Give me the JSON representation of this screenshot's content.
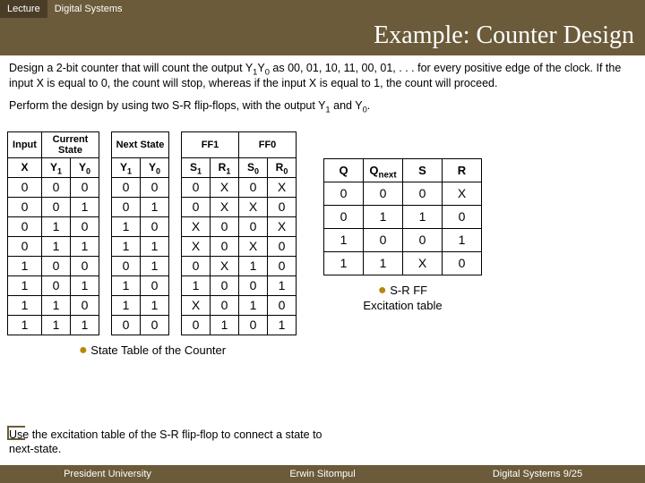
{
  "header": {
    "left": "Lecture",
    "right": "Digital Systems"
  },
  "title": "Example: Counter Design",
  "para1_a": "Design a 2-bit counter that will count the output Y",
  "para1_b": "Y",
  "para1_c": " as 00, 01, 10, 11, 00, 01, . . . for every positive edge of the clock. If the input X is equal to 0, the count will stop, whereas if the input X is equal to 1, the count will proceed.",
  "para2_a": "Perform the design by using two S-R flip-flops, with the output Y",
  "para2_b": " and Y",
  "state_table": {
    "group_headers": [
      "Input",
      "Current State",
      "Next State",
      "FF1",
      "FF0"
    ],
    "sub_headers": [
      "X",
      "Y1",
      "Y0",
      "Y1",
      "Y0",
      "S1",
      "R1",
      "S0",
      "R0"
    ],
    "rows": [
      [
        "0",
        "0",
        "0",
        "0",
        "0",
        "0",
        "X",
        "0",
        "X"
      ],
      [
        "0",
        "0",
        "1",
        "0",
        "1",
        "0",
        "X",
        "X",
        "0"
      ],
      [
        "0",
        "1",
        "0",
        "1",
        "0",
        "X",
        "0",
        "0",
        "X"
      ],
      [
        "0",
        "1",
        "1",
        "1",
        "1",
        "X",
        "0",
        "X",
        "0"
      ],
      [
        "1",
        "0",
        "0",
        "0",
        "1",
        "0",
        "X",
        "1",
        "0"
      ],
      [
        "1",
        "0",
        "1",
        "1",
        "0",
        "1",
        "0",
        "0",
        "1"
      ],
      [
        "1",
        "1",
        "0",
        "1",
        "1",
        "X",
        "0",
        "1",
        "0"
      ],
      [
        "1",
        "1",
        "1",
        "0",
        "0",
        "0",
        "1",
        "0",
        "1"
      ]
    ],
    "caption": "State Table of the Counter"
  },
  "excite_table": {
    "headers": [
      "Q",
      "Qnext",
      "S",
      "R"
    ],
    "rows": [
      [
        "0",
        "0",
        "0",
        "X"
      ],
      [
        "0",
        "1",
        "1",
        "0"
      ],
      [
        "1",
        "0",
        "0",
        "1"
      ],
      [
        "1",
        "1",
        "X",
        "0"
      ]
    ],
    "caption_a": "S-R FF",
    "caption_b": "Excitation table"
  },
  "use_text": "Use the excitation table of the S-R flip-flop to connect a state to next-state.",
  "footer": {
    "left": "President University",
    "center": "Erwin Sitompul",
    "right": "Digital Systems 9/25"
  }
}
